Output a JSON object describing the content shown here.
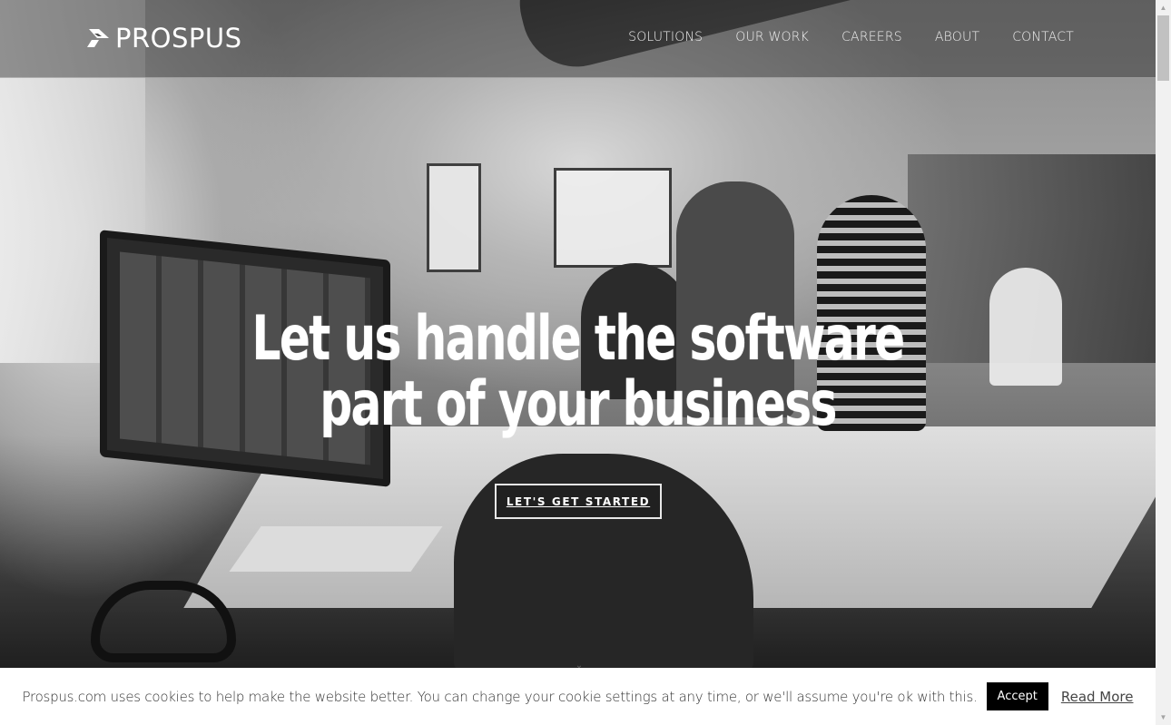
{
  "header": {
    "logo_text": "PROSPUS",
    "nav": [
      {
        "label": "SOLUTIONS"
      },
      {
        "label": "OUR WORK"
      },
      {
        "label": "CAREERS"
      },
      {
        "label": "ABOUT"
      },
      {
        "label": "CONTACT"
      }
    ]
  },
  "hero": {
    "title_line1": "Let us handle the software",
    "title_line2": "part of your business",
    "cta_label": "LET'S GET STARTED"
  },
  "cookie_bar": {
    "message": "Prospus.com uses cookies to help make the website better. You can change your cookie settings at any time, or we'll assume you're ok with this.",
    "accept_label": "Accept",
    "read_more_label": "Read More"
  },
  "scrollbar": {
    "up_icon": "▲",
    "down_icon": "▼"
  },
  "colors": {
    "cookie_bg": "#ffffff",
    "accept_bg": "#000000",
    "text_white": "#ffffff"
  }
}
